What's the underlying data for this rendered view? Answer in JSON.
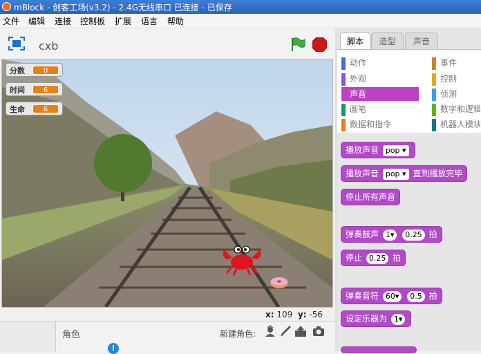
{
  "window": {
    "title": "mBlock - 创客工场(v3.2) - 2.4G无线串口 已连接 - 已保存"
  },
  "menu": [
    "文件",
    "编辑",
    "连接",
    "控制板",
    "扩展",
    "语言",
    "帮助"
  ],
  "stage_header": {
    "project_name": "cxb"
  },
  "monitors": [
    {
      "label": "分数",
      "value": "0"
    },
    {
      "label": "时间",
      "value": "6"
    },
    {
      "label": "生命",
      "value": "6"
    }
  ],
  "coords": {
    "x_label": "x:",
    "x_value": "109",
    "y_label": "y:",
    "y_value": "-56"
  },
  "sprites": {
    "header": "角色",
    "new_sprite_label": "新建角色:",
    "info": "i"
  },
  "tabs": [
    "脚本",
    "造型",
    "声音"
  ],
  "categories_left": [
    "动作",
    "外观",
    "声音",
    "画笔",
    "数据和指令"
  ],
  "categories_right": [
    "事件",
    "控制",
    "侦测",
    "数字和逻辑",
    "机器人模块"
  ],
  "category_colors": {
    "动作": "#4a6cd4",
    "外观": "#8a55d7",
    "声音": "#bb42c3",
    "画笔": "#0e9a6c",
    "数据和指令": "#ee7d16",
    "事件": "#c88330",
    "控制": "#e1a91a",
    "侦测": "#2ca5e2",
    "数字和逻辑": "#5cb712",
    "机器人模块": "#0e7a8a"
  },
  "selected_category": "声音",
  "blocks": {
    "play_sound": {
      "text": "播放声音",
      "value": "pop"
    },
    "play_sound_wait": {
      "text": "播放声音",
      "value": "pop",
      "suffix": "直到播放完毕"
    },
    "stop_all": {
      "text": "停止所有声音"
    },
    "play_drum": {
      "text": "弹奏鼓声",
      "drum": "1",
      "beats": "0.25",
      "suffix": "拍"
    },
    "rest": {
      "text": "停止",
      "beats": "0.25",
      "suffix": "拍"
    },
    "play_note": {
      "text": "弹奏音符",
      "note": "60",
      "beats": "0.5",
      "suffix": "拍"
    },
    "set_instrument": {
      "text": "设定乐器为",
      "value": "1"
    }
  },
  "colors": {
    "sound_block": "#b249c8",
    "monitor_value": "#ea7f17",
    "title_bar": "#3270c8"
  }
}
